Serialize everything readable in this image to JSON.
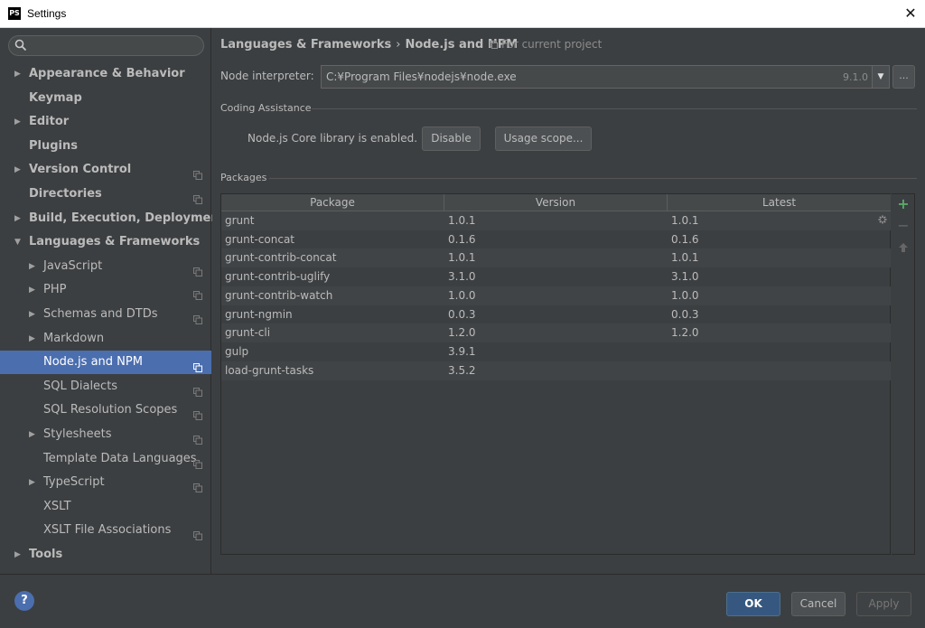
{
  "window": {
    "title": "Settings",
    "app_icon": "PS"
  },
  "search": {
    "placeholder": ""
  },
  "sidebar": {
    "items": [
      {
        "label": "Appearance & Behavior",
        "expandable": true,
        "expanded": false,
        "bold": true,
        "project_icon": false
      },
      {
        "label": "Keymap",
        "expandable": false,
        "bold": true,
        "project_icon": false
      },
      {
        "label": "Editor",
        "expandable": true,
        "expanded": false,
        "bold": true,
        "project_icon": false
      },
      {
        "label": "Plugins",
        "expandable": false,
        "bold": true,
        "project_icon": false
      },
      {
        "label": "Version Control",
        "expandable": true,
        "expanded": false,
        "bold": true,
        "project_icon": true
      },
      {
        "label": "Directories",
        "expandable": false,
        "bold": true,
        "project_icon": true
      },
      {
        "label": "Build, Execution, Deployment",
        "expandable": true,
        "expanded": false,
        "bold": true,
        "project_icon": false
      },
      {
        "label": "Languages & Frameworks",
        "expandable": true,
        "expanded": true,
        "bold": true,
        "project_icon": false
      },
      {
        "label": "JavaScript",
        "expandable": true,
        "expanded": false,
        "bold": false,
        "project_icon": true
      },
      {
        "label": "PHP",
        "expandable": true,
        "expanded": false,
        "bold": false,
        "project_icon": true
      },
      {
        "label": "Schemas and DTDs",
        "expandable": true,
        "expanded": false,
        "bold": false,
        "project_icon": true
      },
      {
        "label": "Markdown",
        "expandable": true,
        "expanded": false,
        "bold": false,
        "project_icon": false
      },
      {
        "label": "Node.js and NPM",
        "expandable": false,
        "bold": false,
        "project_icon": true,
        "selected": true
      },
      {
        "label": "SQL Dialects",
        "expandable": false,
        "bold": false,
        "project_icon": true
      },
      {
        "label": "SQL Resolution Scopes",
        "expandable": false,
        "bold": false,
        "project_icon": true
      },
      {
        "label": "Stylesheets",
        "expandable": true,
        "expanded": false,
        "bold": false,
        "project_icon": true
      },
      {
        "label": "Template Data Languages",
        "expandable": false,
        "bold": false,
        "project_icon": true
      },
      {
        "label": "TypeScript",
        "expandable": true,
        "expanded": false,
        "bold": false,
        "project_icon": true
      },
      {
        "label": "XSLT",
        "expandable": false,
        "bold": false,
        "project_icon": false
      },
      {
        "label": "XSLT File Associations",
        "expandable": false,
        "bold": false,
        "project_icon": true
      },
      {
        "label": "Tools",
        "expandable": true,
        "expanded": false,
        "bold": true,
        "project_icon": false
      }
    ]
  },
  "main": {
    "breadcrumb": {
      "parent": "Languages & Frameworks",
      "separator": "›",
      "current": "Node.js and NPM"
    },
    "scope_note": "For current project",
    "interpreter": {
      "label": "Node interpreter:",
      "path": "C:¥Program Files¥nodejs¥node.exe",
      "version": "9.1.0",
      "browse_label": "..."
    },
    "coding_assistance": {
      "title": "Coding Assistance",
      "status_text": "Node.js Core library is enabled.",
      "disable_label": "Disable",
      "usage_scope_label": "Usage scope..."
    },
    "packages": {
      "title": "Packages",
      "columns": [
        "Package",
        "Version",
        "Latest"
      ],
      "rows": [
        {
          "package": "grunt",
          "version": "1.0.1",
          "latest": "1.0.1"
        },
        {
          "package": "grunt-concat",
          "version": "0.1.6",
          "latest": "0.1.6"
        },
        {
          "package": "grunt-contrib-concat",
          "version": "1.0.1",
          "latest": "1.0.1"
        },
        {
          "package": "grunt-contrib-uglify",
          "version": "3.1.0",
          "latest": "3.1.0"
        },
        {
          "package": "grunt-contrib-watch",
          "version": "1.0.0",
          "latest": "1.0.0"
        },
        {
          "package": "grunt-ngmin",
          "version": "0.0.3",
          "latest": "0.0.3"
        },
        {
          "package": "grunt-cli",
          "version": "1.2.0",
          "latest": "1.2.0"
        },
        {
          "package": "gulp",
          "version": "3.9.1",
          "latest": ""
        },
        {
          "package": "load-grunt-tasks",
          "version": "3.5.2",
          "latest": ""
        }
      ]
    }
  },
  "footer": {
    "ok_label": "OK",
    "cancel_label": "Cancel",
    "apply_label": "Apply",
    "help_label": "?"
  },
  "colors": {
    "background": "#3c3f41",
    "selection": "#4b6eaf",
    "ok_button": "#365880",
    "add_icon": "#59a869"
  }
}
